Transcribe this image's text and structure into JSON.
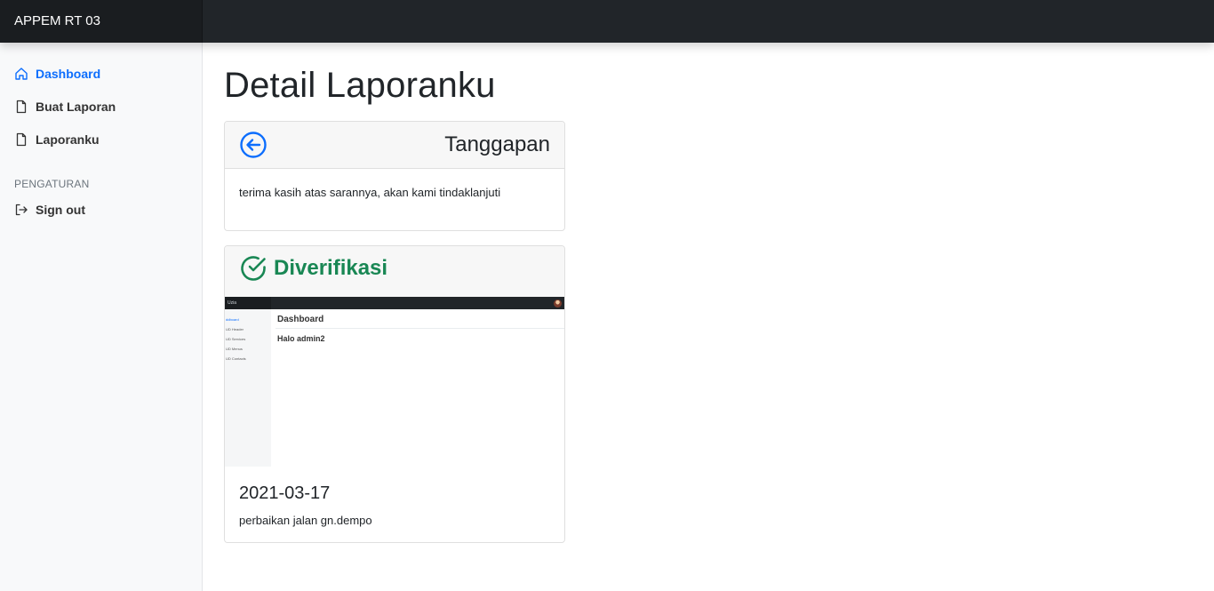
{
  "app": {
    "brand": "APPEM RT 03"
  },
  "sidebar": {
    "items": [
      {
        "label": "Dashboard",
        "icon": "home-icon",
        "active": true
      },
      {
        "label": "Buat Laporan",
        "icon": "file-icon",
        "active": false
      },
      {
        "label": "Laporanku",
        "icon": "file-icon",
        "active": false
      }
    ],
    "section_heading": "PENGATURAN",
    "settings_items": [
      {
        "label": "Sign out",
        "icon": "sign-out-icon"
      }
    ]
  },
  "main": {
    "title": "Detail Laporanku",
    "response_card": {
      "back_icon": "arrow-left-circle-icon",
      "title": "Tanggapan",
      "text": "terima kasih atas sarannya, akan kami tindaklanjuti"
    },
    "report_card": {
      "status_icon": "check-circle-icon",
      "status": "Diverifikasi",
      "screenshot": {
        "brand": "Uzia",
        "nav_items": [
          "ddboard",
          "UD Header",
          "UD Services",
          "UD Menus",
          "UD Contacts"
        ],
        "heading": "Dashboard",
        "greeting": "Halo admin2"
      },
      "date": "2021-03-17",
      "description": "perbaikan jalan gn.dempo"
    }
  },
  "colors": {
    "topbar": "#212529",
    "accent": "#0d6efd",
    "success": "#198754",
    "sidebar_bg": "#f8f9fa"
  }
}
